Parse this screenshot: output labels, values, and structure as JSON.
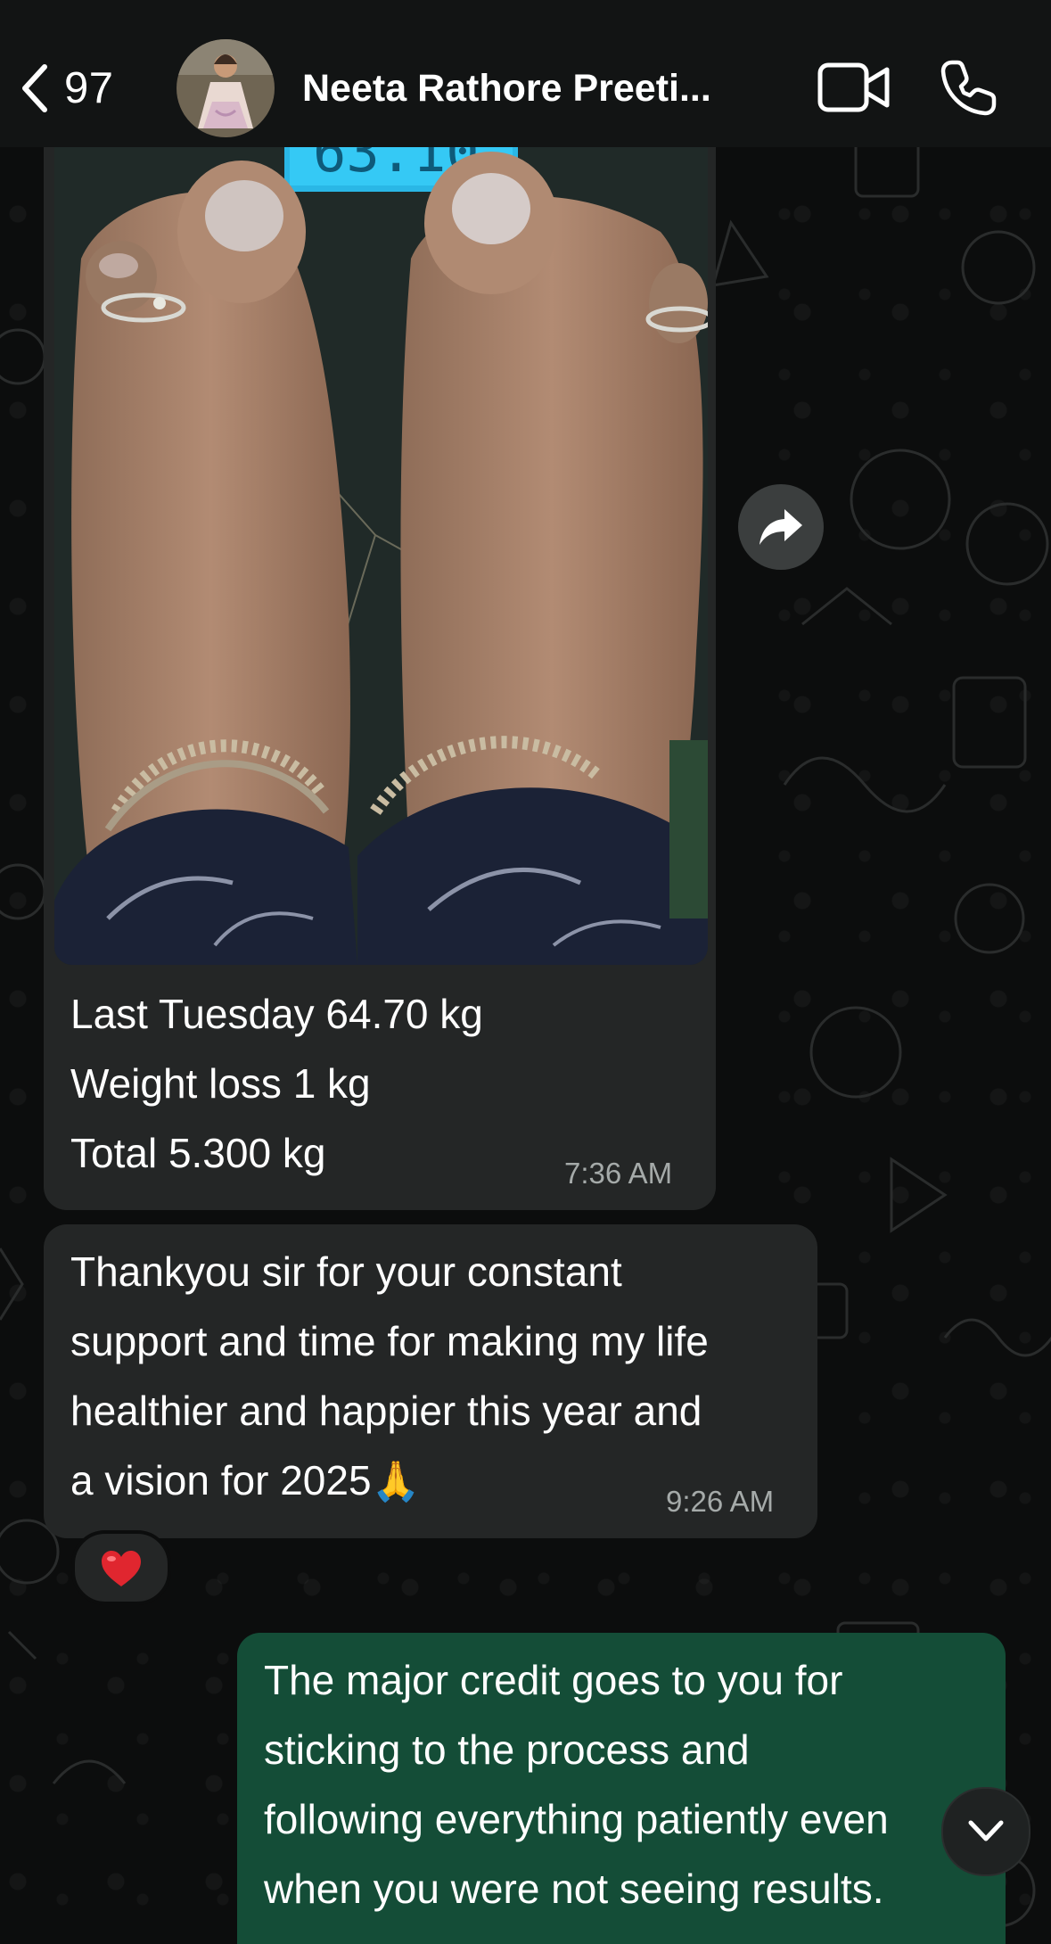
{
  "header": {
    "unread_count": "97",
    "contact_name": "Neeta Rathore Preeti..."
  },
  "messages": {
    "image_message": {
      "caption_lines": [
        "Last Tuesday 64.70 kg",
        "Weight loss 1 kg",
        "Total 5.300 kg"
      ],
      "time": "7:36 AM"
    },
    "text_message": {
      "lines": [
        "Thankyou sir for your constant",
        "support and time for making my life",
        "healthier and happier this year and",
        "a vision for 2025"
      ],
      "emoji": "🙏",
      "time": "9:26 AM",
      "reaction": "❤️"
    },
    "outgoing_message": {
      "lines": [
        "The major credit goes to you for",
        "sticking to the process and",
        "following everything patiently even",
        "when you were not seeing results."
      ]
    }
  },
  "icons": {
    "back": "chevron-left-icon",
    "video": "video-camera-icon",
    "phone": "phone-icon",
    "forward": "forward-arrow-icon",
    "scroll_down": "chevron-down-icon"
  },
  "colors": {
    "header_bg": "#121414",
    "incoming_bubble": "#242626",
    "outgoing_bubble": "#144d37",
    "timestamp": "#a5aaa9"
  }
}
